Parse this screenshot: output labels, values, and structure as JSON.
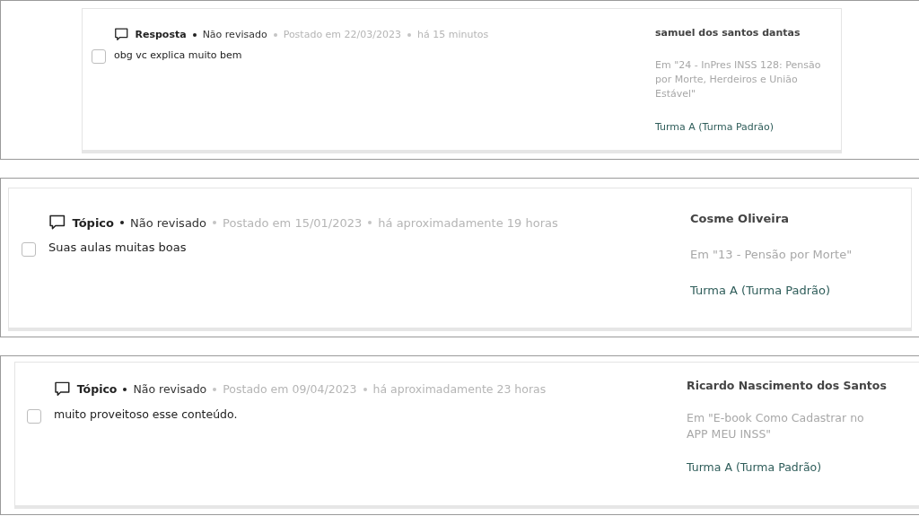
{
  "comments": [
    {
      "type": "Resposta",
      "status": "Não revisado",
      "posted": "Postado em 22/03/2023",
      "ago": "há 15 minutos",
      "body": "obg vc explica muito bem",
      "checked": false,
      "author": "samuel dos santos dantas",
      "topic": "Em \"24 - InPres INSS 128: Pensão por Morte, Herdeiros e União Estável\"",
      "group": "Turma A (Turma Padrão)"
    },
    {
      "type": "Tópico",
      "status": "Não revisado",
      "posted": "Postado em 15/01/2023",
      "ago": "há aproximadamente 19 horas",
      "body": "Suas aulas muitas boas",
      "checked": false,
      "author": "Cosme Oliveira",
      "topic": "Em \"13 - Pensão por Morte\"",
      "group": "Turma A (Turma Padrão)"
    },
    {
      "type": "Tópico",
      "status": "Não revisado",
      "posted": "Postado em 09/04/2023",
      "ago": "há aproximadamente 23 horas",
      "body": "muito proveitoso esse conteúdo.",
      "checked": false,
      "author": "Ricardo Nascimento dos Santos",
      "topic": "Em \"E-book Como Cadastrar no APP MEU INSS\"",
      "group": "Turma A (Turma Padrão)"
    }
  ]
}
